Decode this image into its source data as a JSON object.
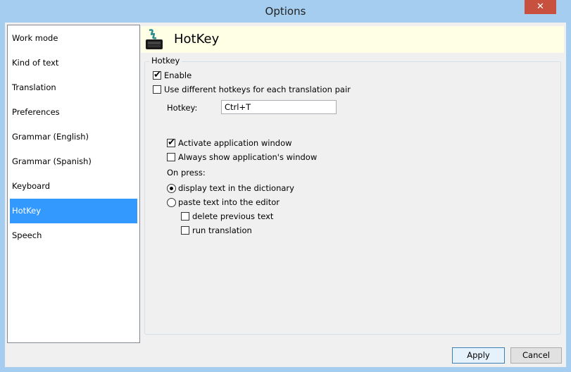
{
  "window": {
    "title": "Options",
    "close_glyph": "✕"
  },
  "sidebar": {
    "items": [
      {
        "label": "Work mode"
      },
      {
        "label": "Kind of text"
      },
      {
        "label": "Translation"
      },
      {
        "label": "Preferences"
      },
      {
        "label": "Grammar (English)"
      },
      {
        "label": "Grammar (Spanish)"
      },
      {
        "label": "Keyboard"
      },
      {
        "label": "HotKey",
        "selected": true
      },
      {
        "label": "Speech"
      }
    ]
  },
  "header": {
    "title": "HotKey",
    "icon": "hotkey-keyboard-icon"
  },
  "group": {
    "label": "Hotkey",
    "enable": {
      "label": "Enable",
      "checked": true
    },
    "different_hotkeys": {
      "label": "Use different hotkeys for each translation pair",
      "checked": false
    },
    "hotkey_label": "Hotkey:",
    "hotkey_value": "Ctrl+T",
    "activate_window": {
      "label": "Activate application window",
      "checked": true
    },
    "always_show": {
      "label": "Always show application's window",
      "checked": false
    },
    "on_press_label": "On press:",
    "display_text": {
      "label": "display text in the dictionary",
      "selected": true
    },
    "paste_text": {
      "label": "paste text into the editor",
      "selected": false
    },
    "delete_previous": {
      "label": "delete previous text",
      "checked": false
    },
    "run_translation": {
      "label": "run translation",
      "checked": false
    }
  },
  "buttons": {
    "apply": "Apply",
    "cancel": "Cancel"
  },
  "colors": {
    "accent": "#3399ff",
    "header_bg": "#ffffe6",
    "titlebar": "#a5cdf0",
    "close": "#c7503e"
  }
}
